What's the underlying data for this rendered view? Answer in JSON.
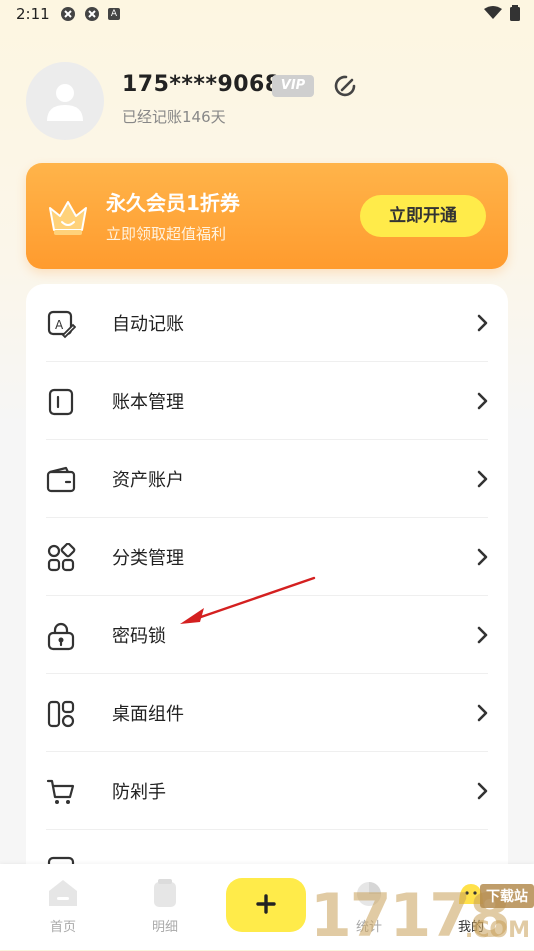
{
  "status_bar": {
    "time": "2:11",
    "notif_letter": "A"
  },
  "profile": {
    "phone": "175****9068",
    "vip_label": "VIP",
    "days_text": "已经记账146天"
  },
  "promo": {
    "title": "永久会员1折券",
    "subtitle": "立即领取超值福利",
    "button_label": "立即开通",
    "colors": {
      "from": "#ffb44a",
      "to": "#ff9b2e",
      "button": "#ffeb4a"
    }
  },
  "menu": {
    "items": [
      {
        "label": "自动记账",
        "icon": "auto-record-icon"
      },
      {
        "label": "账本管理",
        "icon": "ledger-icon"
      },
      {
        "label": "资产账户",
        "icon": "wallet-icon"
      },
      {
        "label": "分类管理",
        "icon": "category-icon"
      },
      {
        "label": "密码锁",
        "icon": "lock-icon"
      },
      {
        "label": "桌面组件",
        "icon": "widget-icon"
      },
      {
        "label": "防剁手",
        "icon": "cart-icon"
      }
    ]
  },
  "bottom_nav": {
    "items": [
      {
        "label": "首页",
        "icon": "home-icon"
      },
      {
        "label": "明细",
        "icon": "detail-icon"
      },
      {
        "label": "统计",
        "icon": "chart-icon"
      },
      {
        "label": "我的",
        "icon": "profile-icon"
      }
    ],
    "add_icon": "plus-icon",
    "accent": "#ffeb4a"
  },
  "watermark": {
    "text_large": "17178",
    "text_small": "下载站",
    "text_domain": ".COM"
  }
}
